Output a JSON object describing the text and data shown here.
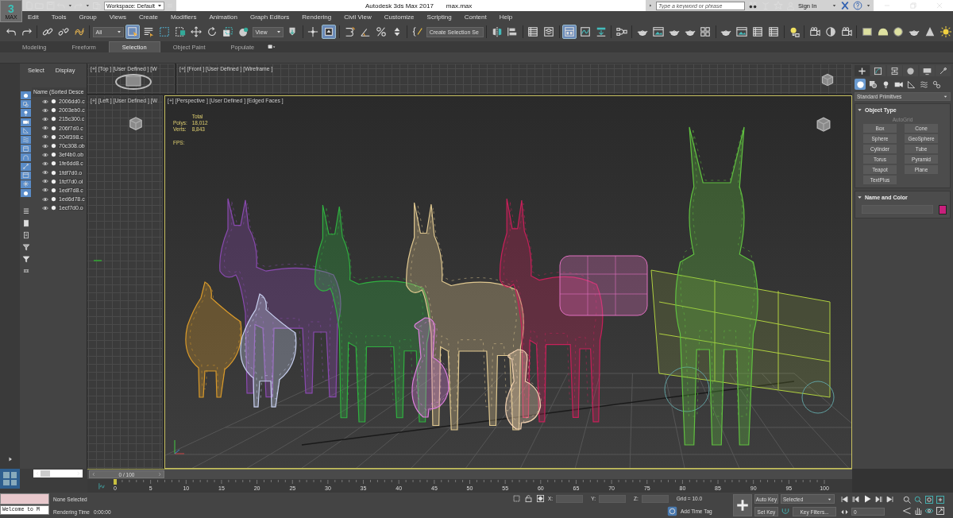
{
  "title_bar": {
    "logo": "3",
    "logo_caption": "MAX",
    "workspace": "Workspace: Default",
    "app_title": "Autodesk 3ds Max 2017",
    "file_name": "max.max",
    "search": {
      "placeholder": "Type a keyword or phrase"
    },
    "sign_in": "Sign In"
  },
  "menu": [
    "Edit",
    "Tools",
    "Group",
    "Views",
    "Create",
    "Modifiers",
    "Animation",
    "Graph Editors",
    "Rendering",
    "Civil View",
    "Customize",
    "Scripting",
    "Content",
    "Help"
  ],
  "toolbar": [
    [
      {
        "kind": "undo",
        "selected": false
      },
      {
        "kind": "redo",
        "selected": false
      }
    ],
    [
      {
        "kind": "link",
        "selected": false
      },
      {
        "kind": "unlink",
        "selected": false
      },
      {
        "kind": "bind",
        "selected": false
      }
    ],
    [
      {
        "kind": "dropdown",
        "value": "All"
      },
      {
        "kind": "select",
        "selected": true
      },
      {
        "kind": "namelist",
        "selected": false
      },
      {
        "kind": "region",
        "selected": false
      },
      {
        "kind": "crossing",
        "selected": false
      },
      {
        "kind": "move",
        "selected": false
      },
      {
        "kind": "rotate",
        "selected": false
      },
      {
        "kind": "scale",
        "selected": false
      },
      {
        "kind": "place",
        "selected": false
      },
      {
        "kind": "dropdown",
        "value": "View"
      },
      {
        "kind": "pivot",
        "selected": false
      }
    ],
    [
      {
        "kind": "center",
        "selected": false
      },
      {
        "kind": "manipulate",
        "selected": true
      }
    ],
    [
      {
        "kind": "snap",
        "selected": false
      },
      {
        "kind": "angle",
        "selected": false
      },
      {
        "kind": "percent",
        "selected": false
      },
      {
        "kind": "spinner",
        "selected": false
      }
    ],
    [
      {
        "kind": "braces",
        "selected": false
      },
      {
        "kind": "field",
        "placeholder": "Create Selection Se"
      }
    ],
    [
      {
        "kind": "mirror",
        "selected": false
      },
      {
        "kind": "align",
        "selected": false
      }
    ],
    [
      {
        "kind": "table",
        "selected": false
      },
      {
        "kind": "layers",
        "selected": false
      }
    ],
    [
      {
        "kind": "ribbon",
        "selected": true
      },
      {
        "kind": "curve",
        "selected": false
      },
      {
        "kind": "dope",
        "selected": false
      }
    ],
    [
      {
        "kind": "schematic",
        "selected": false
      }
    ],
    [
      {
        "kind": "teapot",
        "selected": false
      },
      {
        "kind": "window",
        "selected": false
      },
      {
        "kind": "teapot",
        "selected": false
      },
      {
        "kind": "teapot",
        "selected": false
      },
      {
        "kind": "quad",
        "selected": false
      }
    ],
    [
      {
        "kind": "teapot",
        "selected": false
      },
      {
        "kind": "window",
        "selected": false
      },
      {
        "kind": "table",
        "selected": false
      },
      {
        "kind": "table",
        "selected": false
      }
    ],
    [
      {
        "kind": "bulb",
        "selected": false
      }
    ],
    [
      {
        "kind": "camera",
        "selected": false
      },
      {
        "kind": "halfsphere",
        "selected": false
      },
      {
        "kind": "camera",
        "selected": false
      }
    ],
    [
      {
        "kind": "rectangle",
        "selected": false
      },
      {
        "kind": "dome",
        "selected": false
      },
      {
        "kind": "circle",
        "selected": false
      },
      {
        "kind": "teapot",
        "selected": false
      },
      {
        "kind": "cone",
        "selected": false
      },
      {
        "kind": "sun",
        "selected": false
      }
    ]
  ],
  "ribbon_tabs": [
    {
      "label": "Modeling",
      "selected": false
    },
    {
      "label": "Freeform",
      "selected": false
    },
    {
      "label": "Selection",
      "selected": true
    },
    {
      "label": "Object Paint",
      "selected": false
    },
    {
      "label": "Populate",
      "selected": false
    }
  ],
  "scene_explorer": {
    "tabs": [
      "Select",
      "Display"
    ],
    "column": "Name (Sorted Desce",
    "filters": [
      {
        "kind": "circle",
        "on": true
      },
      {
        "kind": "shapes",
        "on": true
      },
      {
        "kind": "bulb",
        "on": true
      },
      {
        "kind": "camera",
        "on": true
      },
      {
        "kind": "triangle",
        "on": true
      },
      {
        "kind": "waves",
        "on": true
      },
      {
        "kind": "box",
        "on": true
      },
      {
        "kind": "arch",
        "on": true
      },
      {
        "kind": "bone",
        "on": true
      },
      {
        "kind": "frame",
        "on": true
      },
      {
        "kind": "snow",
        "on": true
      },
      {
        "kind": "circle",
        "on": true
      }
    ],
    "objects": [
      "2006dd0.c",
      "2003eb0.c",
      "215c300.c",
      "206f7d0.c",
      "204f398.c",
      "70c308.ob",
      "3ef4b0.ob",
      "1fe6dd8.c",
      "1fdf7d0.o",
      "1fcf7d0.ol",
      "1edf7d8.c",
      "1ed6d78.c",
      "1ecf7d0.o"
    ]
  },
  "viewports": [
    {
      "label": "[+] [Top ] [User Defined ] [W",
      "active": false
    },
    {
      "label": "[+] [Front ] [User Defined ] [Wireframe ]",
      "active": false
    },
    {
      "label": "[+] [Left ] [User Defined ] [W",
      "active": false
    },
    {
      "label": "[+] [Perspective ] [User Defined ] [Edged Faces ]",
      "active": true
    }
  ],
  "statistics": {
    "header": "Total",
    "rows": [
      {
        "label": "Polys:",
        "value": "18,012"
      },
      {
        "label": "Verts:",
        "value": "8,843"
      }
    ],
    "fps": "FPS:"
  },
  "command_panel": {
    "tabs": [
      {
        "kind": "create",
        "selected": true
      },
      {
        "kind": "modify",
        "selected": false
      },
      {
        "kind": "hierarchy",
        "selected": false
      },
      {
        "kind": "motion",
        "selected": false
      },
      {
        "kind": "display",
        "selected": false
      },
      {
        "kind": "utilities",
        "selected": false
      }
    ],
    "categories": [
      {
        "kind": "geometry",
        "selected": true
      },
      {
        "kind": "shapes",
        "selected": false
      },
      {
        "kind": "lights",
        "selected": false
      },
      {
        "kind": "cameras",
        "selected": false
      },
      {
        "kind": "helpers",
        "selected": false
      },
      {
        "kind": "spacewarps",
        "selected": false
      },
      {
        "kind": "systems",
        "selected": false
      }
    ],
    "type_dropdown": "Standard Primitives",
    "object_type": {
      "title": "Object Type",
      "expanded": true,
      "autogrid": {
        "label": "AutoGrid",
        "disabled": true
      },
      "buttons": [
        "Box",
        "Cone",
        "Sphere",
        "GeoSphere",
        "Cylinder",
        "Tube",
        "Torus",
        "Pyramid",
        "Teapot",
        "Plane",
        "TextPlus"
      ]
    },
    "name_and_color": {
      "title": "Name and Color",
      "expanded": true,
      "color": "#c8207c"
    }
  },
  "time_slider": {
    "label": "0 / 100",
    "level": 0
  },
  "track_bar": {
    "ticks": [
      "0",
      "5",
      "10",
      "15",
      "20",
      "25",
      "30",
      "35",
      "40",
      "45",
      "50",
      "55",
      "60",
      "65",
      "70",
      "75",
      "80",
      "85",
      "90",
      "95",
      "100"
    ]
  },
  "status_bar": {
    "listener_text": "Welcome to M",
    "selection": "None Selected",
    "render_time_label": "Rendering Time",
    "render_time": "0:00:00",
    "coords": [
      "X:",
      "Y:",
      "Z:"
    ],
    "grid": "Grid = 10.0",
    "time_tag": "Add Time Tag",
    "auto_key": {
      "label": "Auto Key",
      "on": false
    },
    "key_mode": "Selected",
    "set_key": "Set Key",
    "key_filters": "Key Filters...",
    "frame": "0"
  }
}
